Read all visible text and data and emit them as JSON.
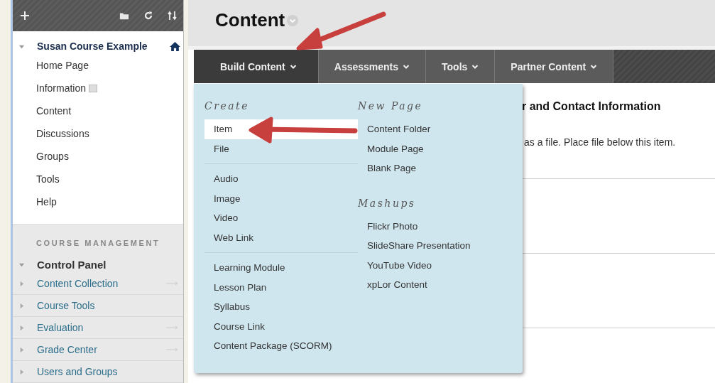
{
  "sidebar": {
    "course_menu": {
      "title": "Susan Course Example",
      "expanded": true,
      "items": [
        {
          "label": "Home Page",
          "icon": false
        },
        {
          "label": "Information",
          "icon": true
        },
        {
          "label": "Content",
          "icon": false
        },
        {
          "label": "Discussions",
          "icon": false
        },
        {
          "label": "Groups",
          "icon": false
        },
        {
          "label": "Tools",
          "icon": false
        },
        {
          "label": "Help",
          "icon": false
        }
      ]
    },
    "management": {
      "heading": "COURSE MANAGEMENT",
      "panel": {
        "label": "Control Panel",
        "expanded": true
      },
      "items": [
        {
          "label": "Content Collection",
          "expanded": false,
          "quick_link": true
        },
        {
          "label": "Course Tools",
          "expanded": false,
          "quick_link": false
        },
        {
          "label": "Evaluation",
          "expanded": false,
          "quick_link": true
        },
        {
          "label": "Grade Center",
          "expanded": false,
          "quick_link": true
        },
        {
          "label": "Users and Groups",
          "expanded": false,
          "quick_link": false
        }
      ]
    }
  },
  "page": {
    "title": "Content"
  },
  "nav": [
    {
      "label": "Build Content",
      "selected": true
    },
    {
      "label": "Assessments",
      "selected": false
    },
    {
      "label": "Tools",
      "selected": false
    },
    {
      "label": "Partner Content",
      "selected": false
    }
  ],
  "menu": {
    "columns": [
      {
        "sections": [
          {
            "heading": "Create",
            "items": [
              {
                "label": "Item",
                "selected": true
              },
              {
                "label": "File",
                "selected": false
              }
            ]
          },
          {
            "items": [
              {
                "label": "Audio",
                "selected": false
              },
              {
                "label": "Image",
                "selected": false
              },
              {
                "label": "Video",
                "selected": false
              },
              {
                "label": "Web Link",
                "selected": false
              }
            ]
          },
          {
            "items": [
              {
                "label": "Learning Module",
                "selected": false
              },
              {
                "label": "Lesson Plan",
                "selected": false
              },
              {
                "label": "Syllabus",
                "selected": false
              },
              {
                "label": "Course Link",
                "selected": false
              },
              {
                "label": "Content Package (SCORM)",
                "selected": false
              }
            ]
          }
        ]
      },
      {
        "sections": [
          {
            "heading": "New Page",
            "items": [
              {
                "label": "Content Folder",
                "selected": false
              },
              {
                "label": "Module Page",
                "selected": false
              },
              {
                "label": "Blank Page",
                "selected": false
              }
            ]
          },
          {
            "heading": "Mashups",
            "items": [
              {
                "label": "Flickr Photo",
                "selected": false
              },
              {
                "label": "SlideShare Presentation",
                "selected": false
              },
              {
                "label": "YouTube Video",
                "selected": false
              },
              {
                "label": "xpLor Content",
                "selected": false
              }
            ]
          }
        ]
      }
    ]
  },
  "content": {
    "heading": "r and Contact Information",
    "text": "as a file. Place file below this item."
  }
}
